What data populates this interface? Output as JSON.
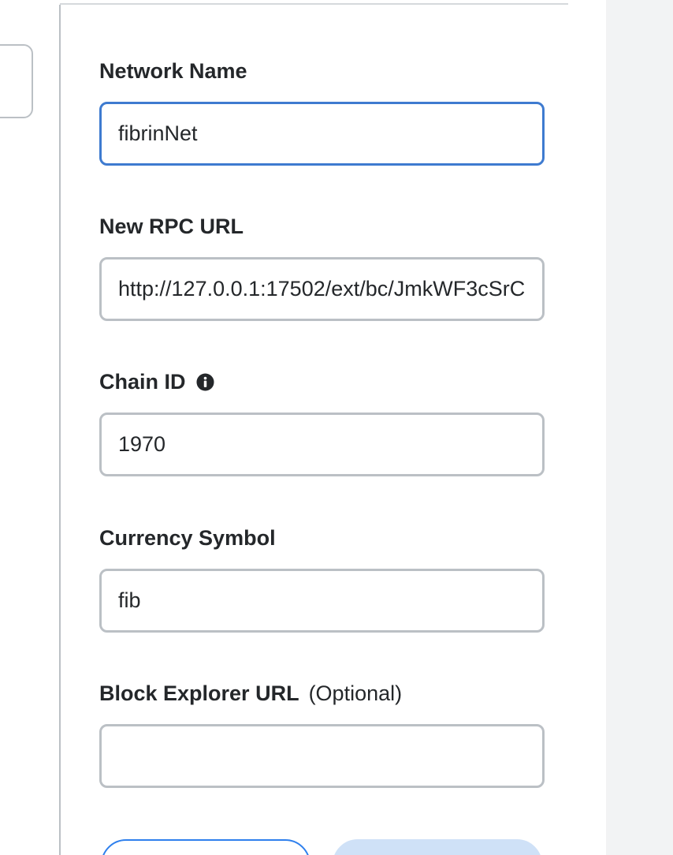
{
  "form": {
    "network_name": {
      "label": "Network Name",
      "value": "fibrinNet"
    },
    "rpc_url": {
      "label": "New RPC URL",
      "value": "http://127.0.0.1:17502/ext/bc/JmkWF3cSrC"
    },
    "chain_id": {
      "label": "Chain ID",
      "info_icon": "info-icon",
      "value": "1970"
    },
    "currency_symbol": {
      "label": "Currency Symbol",
      "value": "fib"
    },
    "block_explorer": {
      "label": "Block Explorer URL",
      "optional_label": "(Optional)",
      "value": ""
    }
  },
  "colors": {
    "focus_border": "#3e7bd0",
    "input_border": "#bbc0c5",
    "text": "#24272a",
    "cancel_border": "#2f80ed",
    "save_disabled_bg": "#cfe1f7",
    "gutter_bg": "#f2f3f4"
  }
}
